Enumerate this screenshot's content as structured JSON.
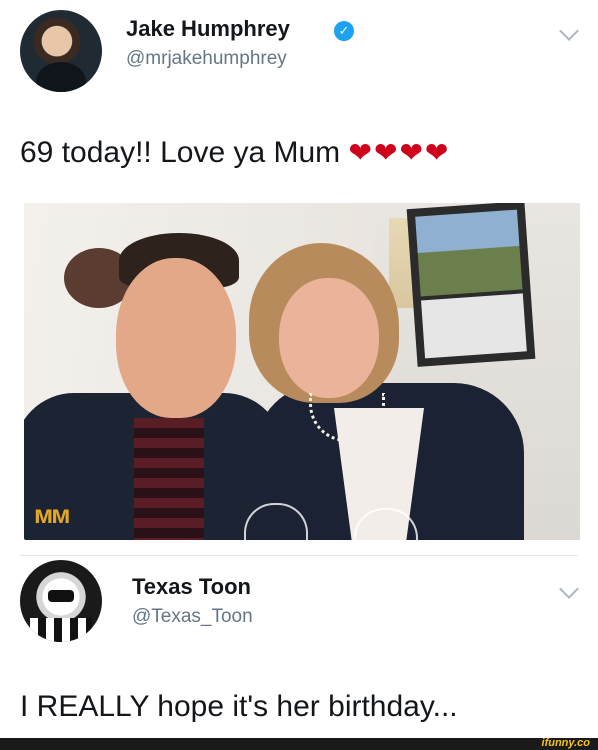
{
  "tweet": {
    "author": {
      "name": "Jake Humphrey",
      "handle": "@mrjakehumphrey",
      "verified": true,
      "avatar_icon": "profile-photo"
    },
    "text": "69 today!! Love ya Mum",
    "emoji": "❤❤❤❤",
    "photo": {
      "overlay_text": "ᴍᴍ"
    }
  },
  "reply": {
    "author": {
      "name": "Texas Toon",
      "handle": "@Texas_Toon",
      "avatar_icon": "stormtrooper-avatar"
    },
    "text": "I REALLY hope it's her birthday..."
  },
  "watermark": "ifunny.co",
  "colors": {
    "verified_blue": "#1da1f2",
    "handle_gray": "#657786",
    "heart_red": "#d0021b"
  }
}
